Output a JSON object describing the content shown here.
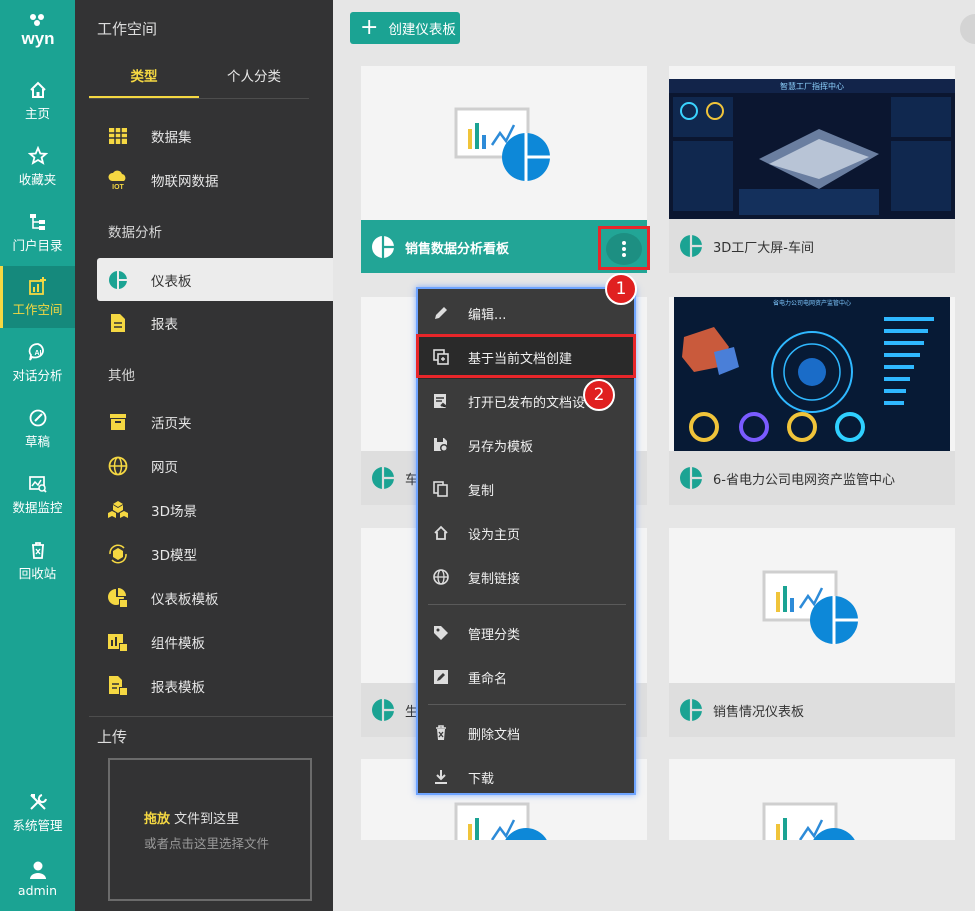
{
  "rail": {
    "items": [
      {
        "label": "主页",
        "icon": "home-icon"
      },
      {
        "label": "收藏夹",
        "icon": "star-icon"
      },
      {
        "label": "门户目录",
        "icon": "tree-icon"
      },
      {
        "label": "工作空间",
        "icon": "workspace-icon"
      },
      {
        "label": "对话分析",
        "icon": "ai-chat-icon"
      },
      {
        "label": "草稿",
        "icon": "draft-icon"
      },
      {
        "label": "数据监控",
        "icon": "monitor-icon"
      },
      {
        "label": "回收站",
        "icon": "trash-icon"
      },
      {
        "label": "系统管理",
        "icon": "tools-icon"
      },
      {
        "label": "admin",
        "icon": "user-icon"
      }
    ],
    "active_index": 3
  },
  "panel": {
    "title": "工作空间",
    "tabs": [
      "类型",
      "个人分类"
    ],
    "items": {
      "dataset": "数据集",
      "iot": "物联网数据",
      "sec_analysis": "数据分析",
      "dashboard": "仪表板",
      "report": "报表",
      "sec_other": "其他",
      "binder": "活页夹",
      "webpage": "网页",
      "scene3d": "3D场景",
      "model3d": "3D模型",
      "dash_tpl": "仪表板模板",
      "comp_tpl": "组件模板",
      "report_tpl": "报表模板"
    },
    "upload": {
      "title": "上传",
      "drag": "拖放",
      "drag_rest": " 文件到这里",
      "hint": "或者点击这里选择文件"
    }
  },
  "main": {
    "create_label": "创建仪表板",
    "cards": [
      {
        "name": "销售数据分析看板"
      },
      {
        "name": "3D工厂大屏-车间"
      },
      {
        "name": "车"
      },
      {
        "name": "6-省电力公司电网资产监管中心"
      },
      {
        "name": "生"
      },
      {
        "name": "销售情况仪表板"
      }
    ],
    "dash1_title": "智慧工厂指挥中心",
    "dash2_title": "省电力公司电网资产监管中心"
  },
  "menu": {
    "items": [
      {
        "label": "编辑...",
        "icon": "pencil-icon"
      },
      {
        "label": "基于当前文档创建",
        "icon": "copy-create-icon"
      },
      {
        "label": "打开已发布的文档设",
        "icon": "open-published-icon"
      },
      {
        "label": "另存为模板",
        "icon": "save-template-icon"
      },
      {
        "label": "复制",
        "icon": "duplicate-icon"
      },
      {
        "label": "设为主页",
        "icon": "home-icon"
      },
      {
        "label": "复制链接",
        "icon": "globe-icon"
      },
      {
        "label": "管理分类",
        "icon": "tag-icon"
      },
      {
        "label": "重命名",
        "icon": "rename-icon"
      },
      {
        "label": "删除文档",
        "icon": "delete-icon"
      },
      {
        "label": "下载",
        "icon": "download-icon"
      }
    ]
  },
  "badges": [
    "1",
    "2"
  ],
  "colors": {
    "teal": "#1ba393",
    "yellow": "#f5d842",
    "red": "#e02020",
    "panel": "#333334"
  }
}
